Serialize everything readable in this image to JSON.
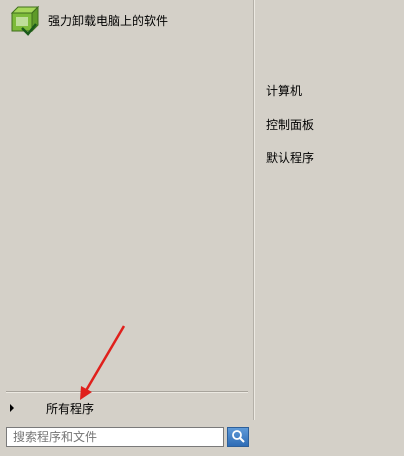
{
  "left_pane": {
    "pinned": [
      {
        "label": "强力卸载电脑上的软件",
        "icon": "uninstall-box-icon"
      }
    ],
    "all_programs": {
      "label": "所有程序",
      "icon": "expand-arrow-icon"
    },
    "search": {
      "value": "",
      "placeholder": "搜索程序和文件",
      "button_icon": "search-magnifier-icon"
    }
  },
  "right_pane": {
    "links": [
      {
        "label": "计算机"
      },
      {
        "label": "控制面板"
      },
      {
        "label": "默认程序"
      }
    ]
  },
  "annotation": {
    "type": "red-arrow",
    "color": "#e0201c",
    "points_to": "all_programs"
  },
  "colors": {
    "menu_bg": "#d4d0c8",
    "search_button": "#3b7bc4",
    "annotation": "#e0201c"
  }
}
